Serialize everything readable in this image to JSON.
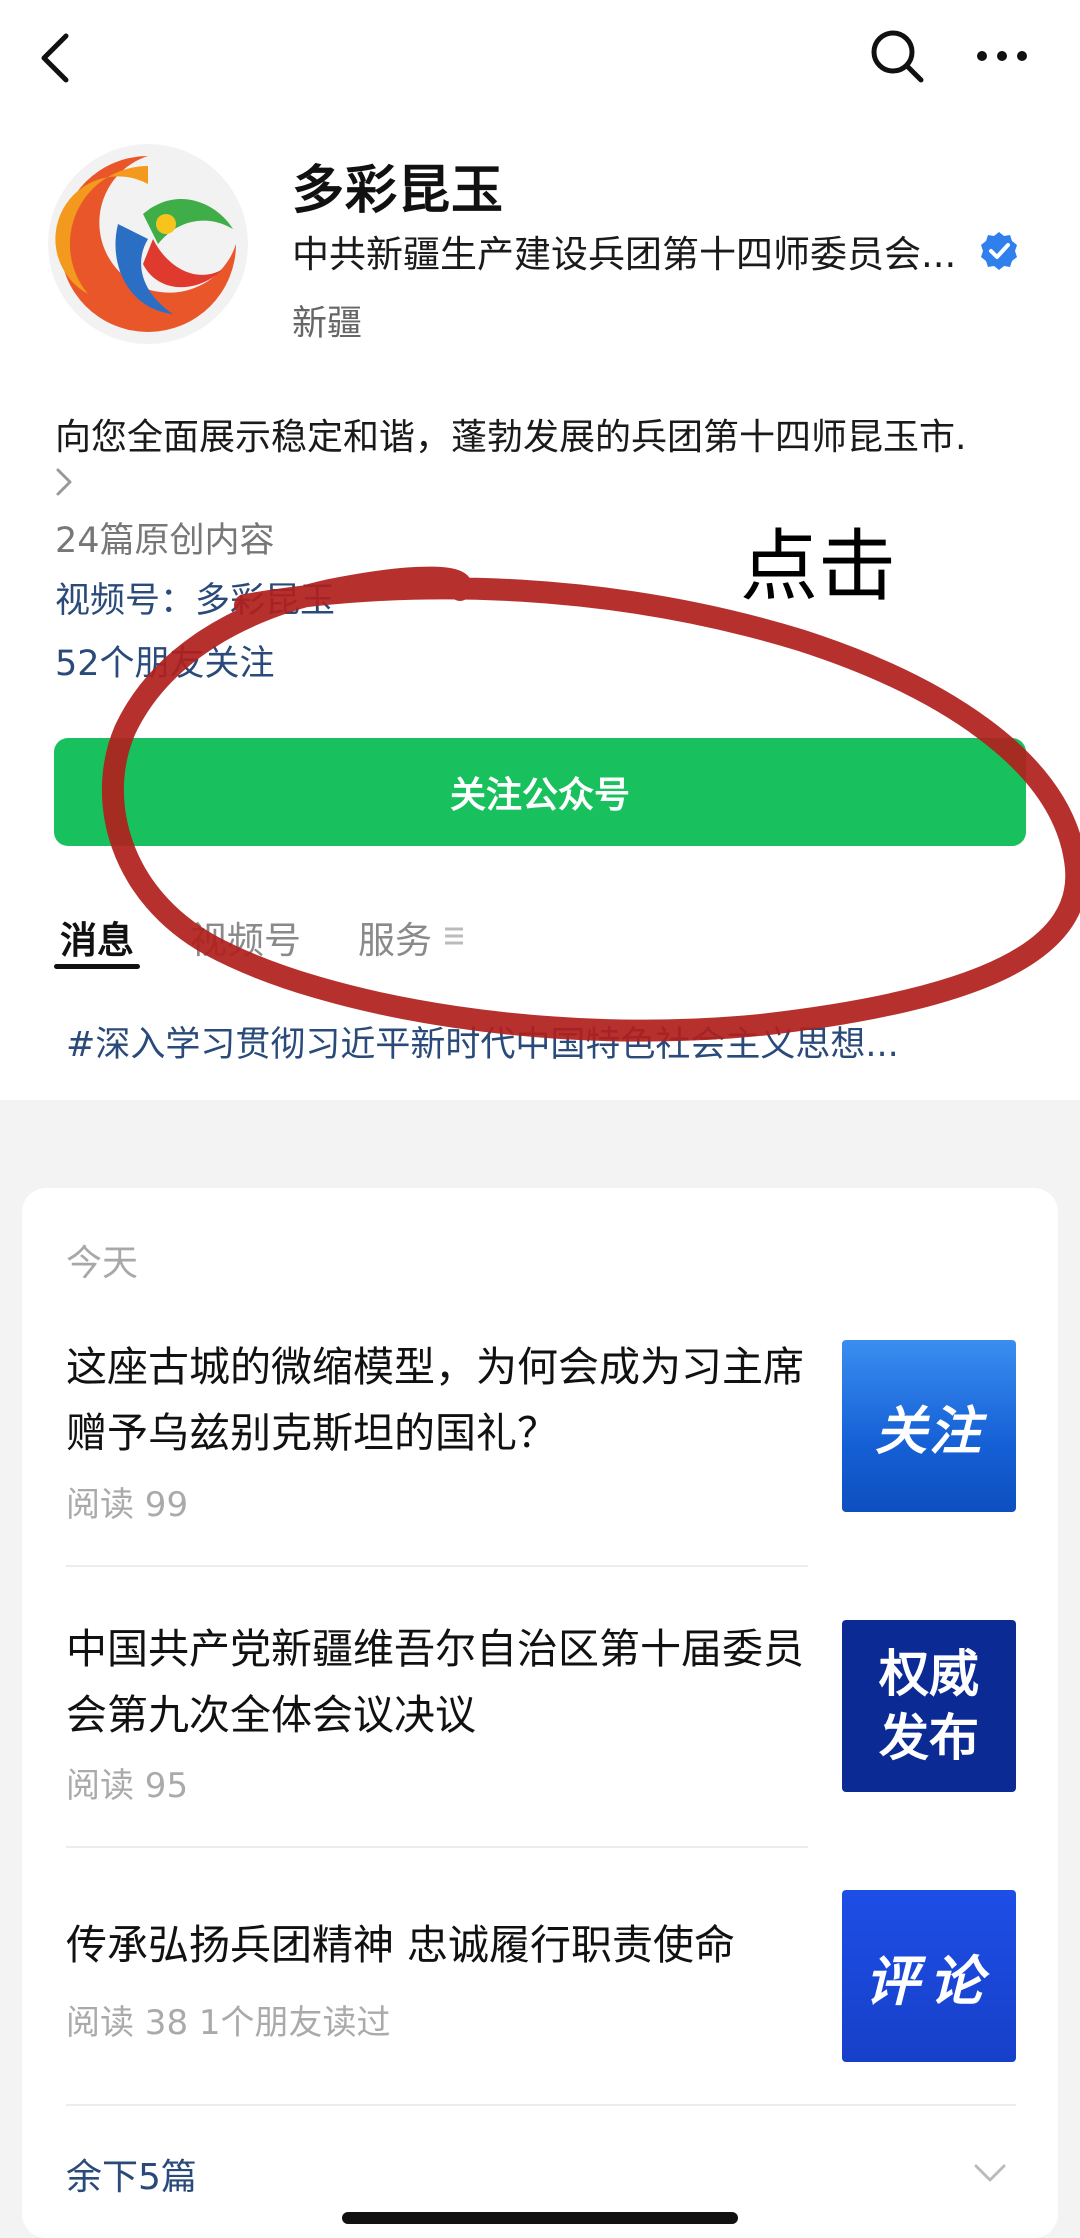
{
  "account": {
    "name": "多彩昆玉",
    "owner": "中共新疆生产建设兵团第十四师委员会...",
    "region": "新疆",
    "description": "向您全面展示稳定和谐，蓬勃发展的兵团第十四师昆玉市.",
    "original_count": "24篇原创内容",
    "channels_link": "视频号：多彩昆玉",
    "friends_following": "52个朋友关注"
  },
  "follow_button": {
    "label": "关注公众号"
  },
  "tabs": [
    {
      "label": "消息",
      "active": true
    },
    {
      "label": "视频号",
      "active": false
    },
    {
      "label": "服务",
      "active": false
    }
  ],
  "topic": "#深入学习贯彻习近平新时代中国特色社会主义思想...",
  "feed": {
    "date_label": "今天",
    "articles": [
      {
        "title": "这座古城的微缩模型，为何会成为习主席赠予乌兹别克斯坦的国礼？",
        "meta": "阅读 99",
        "thumb_text": "关注"
      },
      {
        "title": "中国共产党新疆维吾尔自治区第十届委员会第九次全体会议决议",
        "meta": "阅读 95",
        "thumb_text": "权威发布"
      },
      {
        "title": "传承弘扬兵团精神 忠诚履行职责使命",
        "meta": "阅读 38   1个朋友读过",
        "thumb_text": "评论"
      }
    ],
    "more_label": "余下5篇"
  },
  "annotation": {
    "label": "点击",
    "color": "#b0201c"
  },
  "colors": {
    "accent": "#19c15e",
    "link": "#2a4a7a",
    "verified": "#2f80ed"
  },
  "icons": [
    "back-icon",
    "search-icon",
    "more-icon",
    "verified-icon",
    "chevron-right-icon",
    "menu-lines-icon",
    "chevron-down-icon"
  ]
}
